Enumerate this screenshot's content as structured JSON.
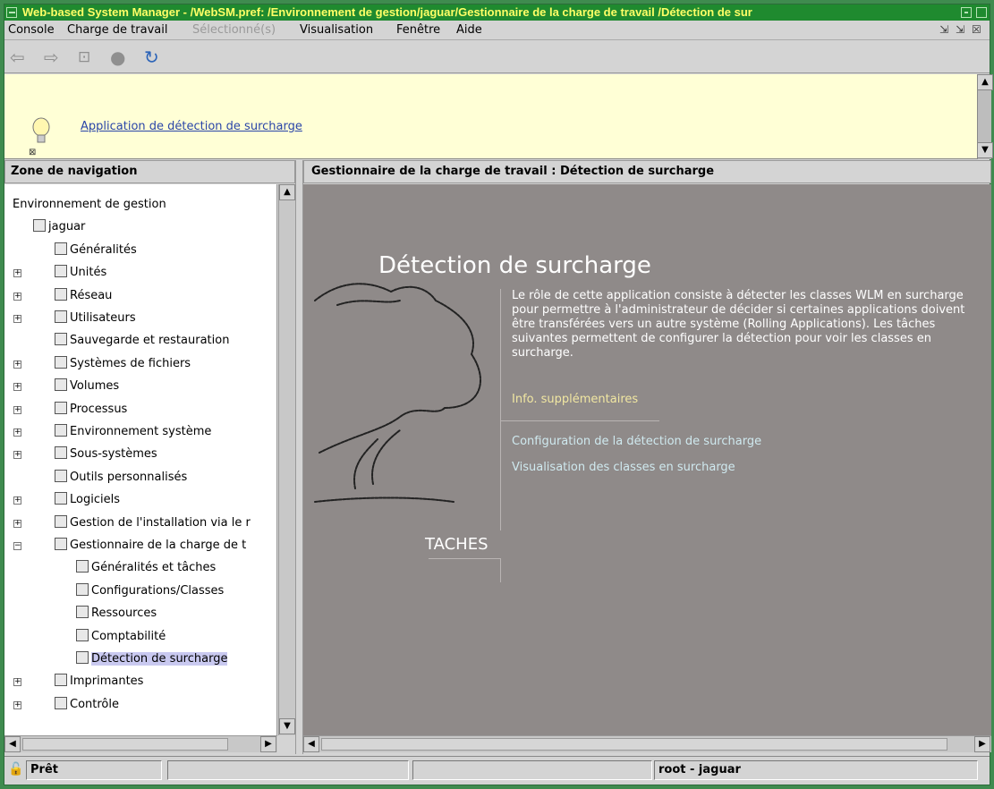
{
  "titlebar": {
    "title": "Web-based System Manager - /WebSM.pref: /Environnement de gestion/jaguar/Gestionnaire de la charge de travail /Détection de sur"
  },
  "menubar": {
    "items": [
      "Console",
      "Charge de travail",
      "Sélectionné(s)",
      "Visualisation",
      "Fenêtre",
      "Aide"
    ]
  },
  "tip": {
    "link": "Application de détection de surcharge"
  },
  "nav": {
    "header": "Zone de navigation",
    "items": [
      {
        "label": "Environnement de gestion",
        "icon": "globe-icon"
      },
      {
        "label": "jaguar",
        "icon": "server-icon"
      },
      {
        "label": "Généralités",
        "icon": "overview-icon"
      },
      {
        "label": "Unités",
        "icon": "devices-icon"
      },
      {
        "label": "Réseau",
        "icon": "network-icon"
      },
      {
        "label": "Utilisateurs",
        "icon": "users-icon"
      },
      {
        "label": "Sauvegarde et restauration",
        "icon": "backup-icon"
      },
      {
        "label": "Systèmes de fichiers",
        "icon": "folder-icon"
      },
      {
        "label": "Volumes",
        "icon": "volumes-icon"
      },
      {
        "label": "Processus",
        "icon": "process-icon"
      },
      {
        "label": "Environnement système",
        "icon": "system-env-icon"
      },
      {
        "label": "Sous-systèmes",
        "icon": "subsystems-icon"
      },
      {
        "label": "Outils personnalisés",
        "icon": "custom-tools-icon"
      },
      {
        "label": "Logiciels",
        "icon": "software-icon"
      },
      {
        "label": "Gestion de l'installation via le r",
        "icon": "install-icon"
      },
      {
        "label": "Gestionnaire de la charge de t",
        "icon": "workload-icon"
      },
      {
        "label": "Généralités et tâches",
        "icon": "overview-icon"
      },
      {
        "label": "Configurations/Classes",
        "icon": "config-icon"
      },
      {
        "label": "Ressources",
        "icon": "resources-icon"
      },
      {
        "label": "Comptabilité",
        "icon": "accounting-icon"
      },
      {
        "label": "Détection de surcharge",
        "icon": "overload-icon"
      },
      {
        "label": "Imprimantes",
        "icon": "printer-icon"
      },
      {
        "label": "Contrôle",
        "icon": "monitor-icon"
      }
    ]
  },
  "content": {
    "header": "Gestionnaire de la charge de travail : Détection de surcharge",
    "title": "Détection de surcharge",
    "description": "Le rôle de cette application consiste à détecter les classes WLM en surcharge pour permettre à l'administrateur de décider si certaines applications doivent être transférées vers un autre système (Rolling Applications). Les tâches suivantes permettent de configurer la détection pour voir les classes en surcharge.",
    "more_info": "Info. supplémentaires",
    "tasks": [
      "Configuration de la détection de surcharge",
      "Visualisation des classes en surcharge"
    ],
    "section_label": "TACHES"
  },
  "status": {
    "state": "Prêt",
    "user": "root - jaguar"
  }
}
